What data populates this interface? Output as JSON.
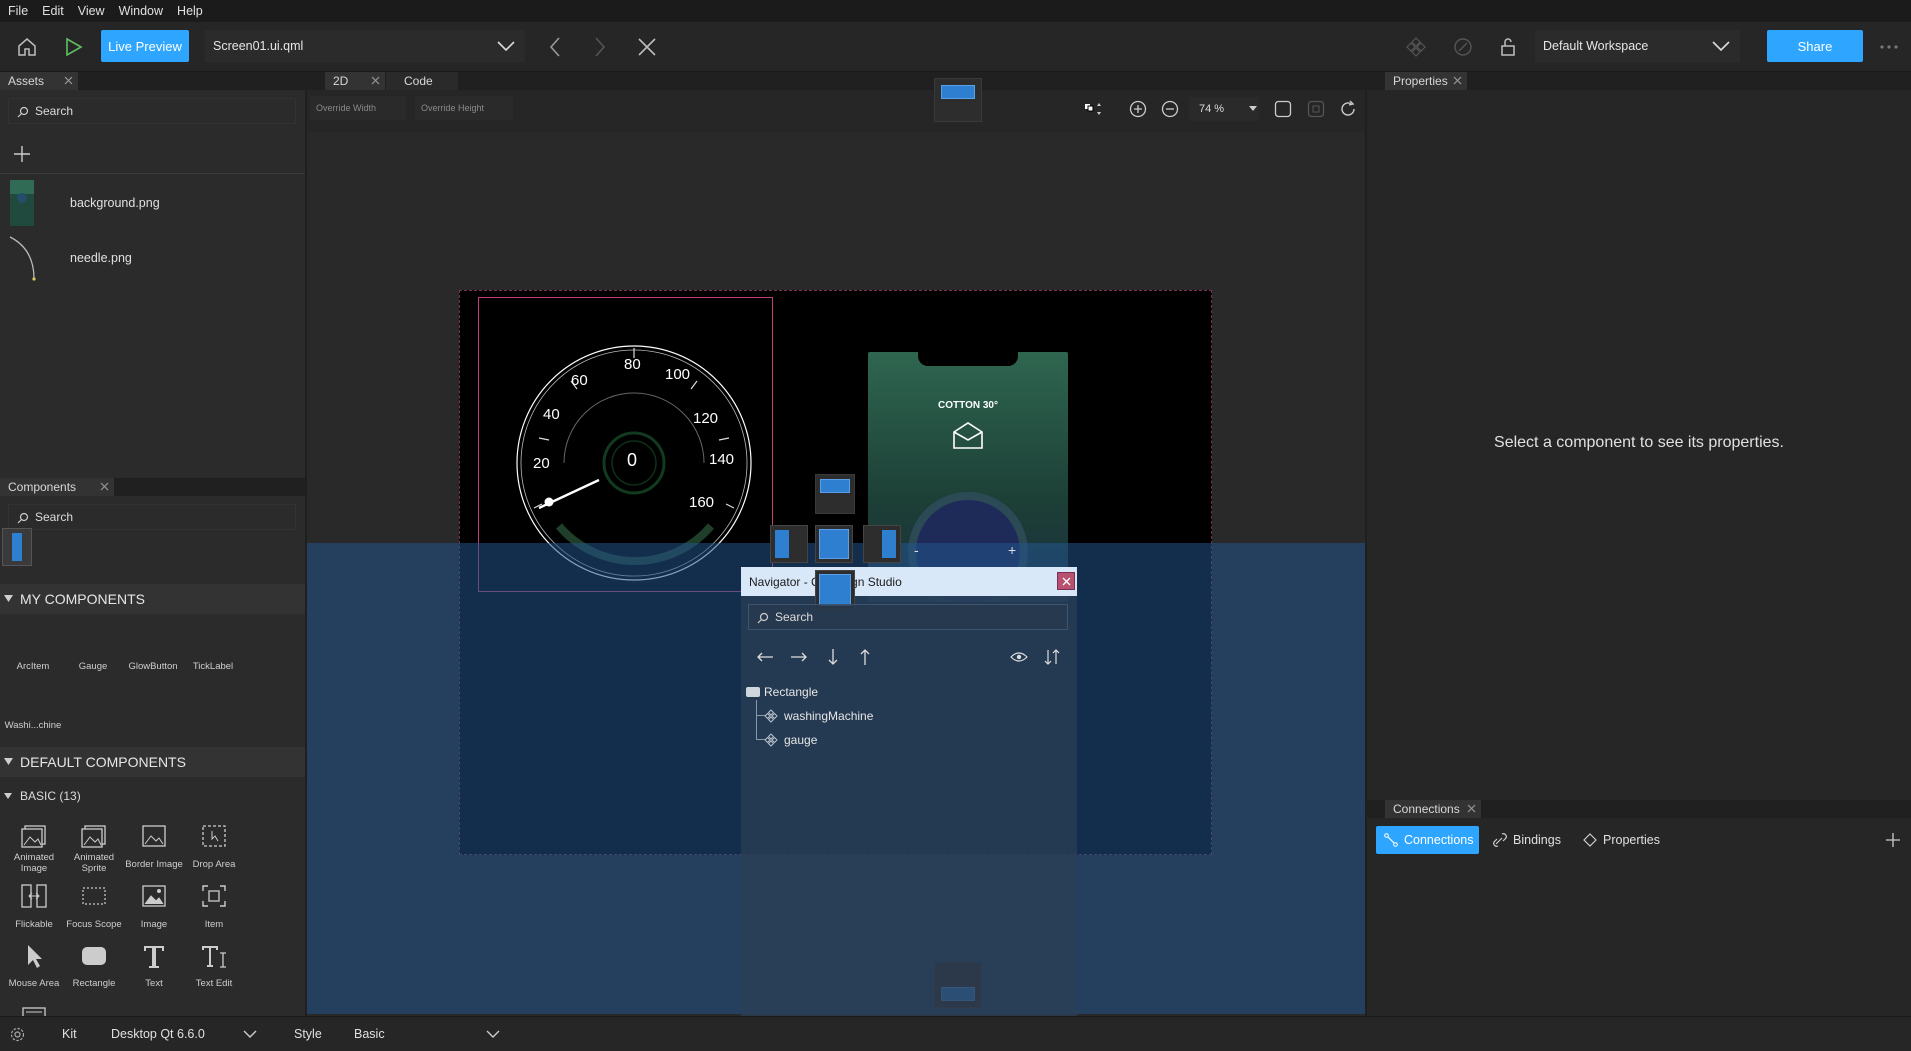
{
  "menu": [
    "File",
    "Edit",
    "View",
    "Window",
    "Help"
  ],
  "toolbar": {
    "live_preview": "Live Preview",
    "current_file": "Screen01.ui.qml",
    "workspace": "Default Workspace",
    "share": "Share"
  },
  "assets": {
    "tab": "Assets",
    "search_placeholder": "Search",
    "items": [
      {
        "name": "background.png",
        "icon": "image-thumbnail"
      },
      {
        "name": "needle.png",
        "icon": "needle-thumbnail"
      }
    ]
  },
  "components": {
    "tab": "Components",
    "search_placeholder": "Search",
    "my_components_header": "MY COMPONENTS",
    "my_components": [
      "ArcItem",
      "Gauge",
      "GlowButton",
      "TickLabel",
      "Washi...chine"
    ],
    "default_components_header": "DEFAULT COMPONENTS",
    "basic_header": "BASIC (13)",
    "basic": [
      {
        "label": "Animated Image",
        "icon": "animated-image-icon"
      },
      {
        "label": "Animated Sprite",
        "icon": "animated-sprite-icon"
      },
      {
        "label": "Border Image",
        "icon": "border-image-icon"
      },
      {
        "label": "Drop Area",
        "icon": "drop-area-icon"
      },
      {
        "label": "Flickable",
        "icon": "flickable-icon"
      },
      {
        "label": "Focus Scope",
        "icon": "focus-scope-icon"
      },
      {
        "label": "Image",
        "icon": "image-icon"
      },
      {
        "label": "Item",
        "icon": "item-icon"
      },
      {
        "label": "Mouse Area",
        "icon": "mouse-area-icon"
      },
      {
        "label": "Rectangle",
        "icon": "rectangle-icon"
      },
      {
        "label": "Text",
        "icon": "text-icon"
      },
      {
        "label": "Text Edit",
        "icon": "text-edit-icon"
      }
    ]
  },
  "canvas": {
    "tabs": [
      "2D",
      "Code"
    ],
    "override_width": "Override Width",
    "override_height": "Override Height",
    "zoom": "74 %",
    "gauge": {
      "labels": [
        "20",
        "40",
        "60",
        "80",
        "100",
        "120",
        "140",
        "160"
      ],
      "center_value": "0"
    },
    "washing_machine": {
      "title": "COTTON 30°",
      "minus": "-",
      "plus": "+"
    }
  },
  "navigator": {
    "title": "Navigator - Qt Design Studio",
    "search_placeholder": "Search",
    "tree": [
      {
        "label": "Rectangle",
        "level": 0
      },
      {
        "label": "washingMachine",
        "level": 1
      },
      {
        "label": "gauge",
        "level": 1
      }
    ]
  },
  "properties": {
    "tab": "Properties",
    "empty_message": "Select a component to see its properties."
  },
  "connections": {
    "tab": "Connections",
    "subtabs": [
      "Connections",
      "Bindings",
      "Properties"
    ]
  },
  "statusbar": {
    "kit_label": "Kit",
    "kit_value": "Desktop Qt 6.6.0",
    "style_label": "Style",
    "style_value": "Basic"
  },
  "colors": {
    "accent": "#2ea6ff",
    "selection": "#c2407a",
    "overlay": "#22548c"
  }
}
